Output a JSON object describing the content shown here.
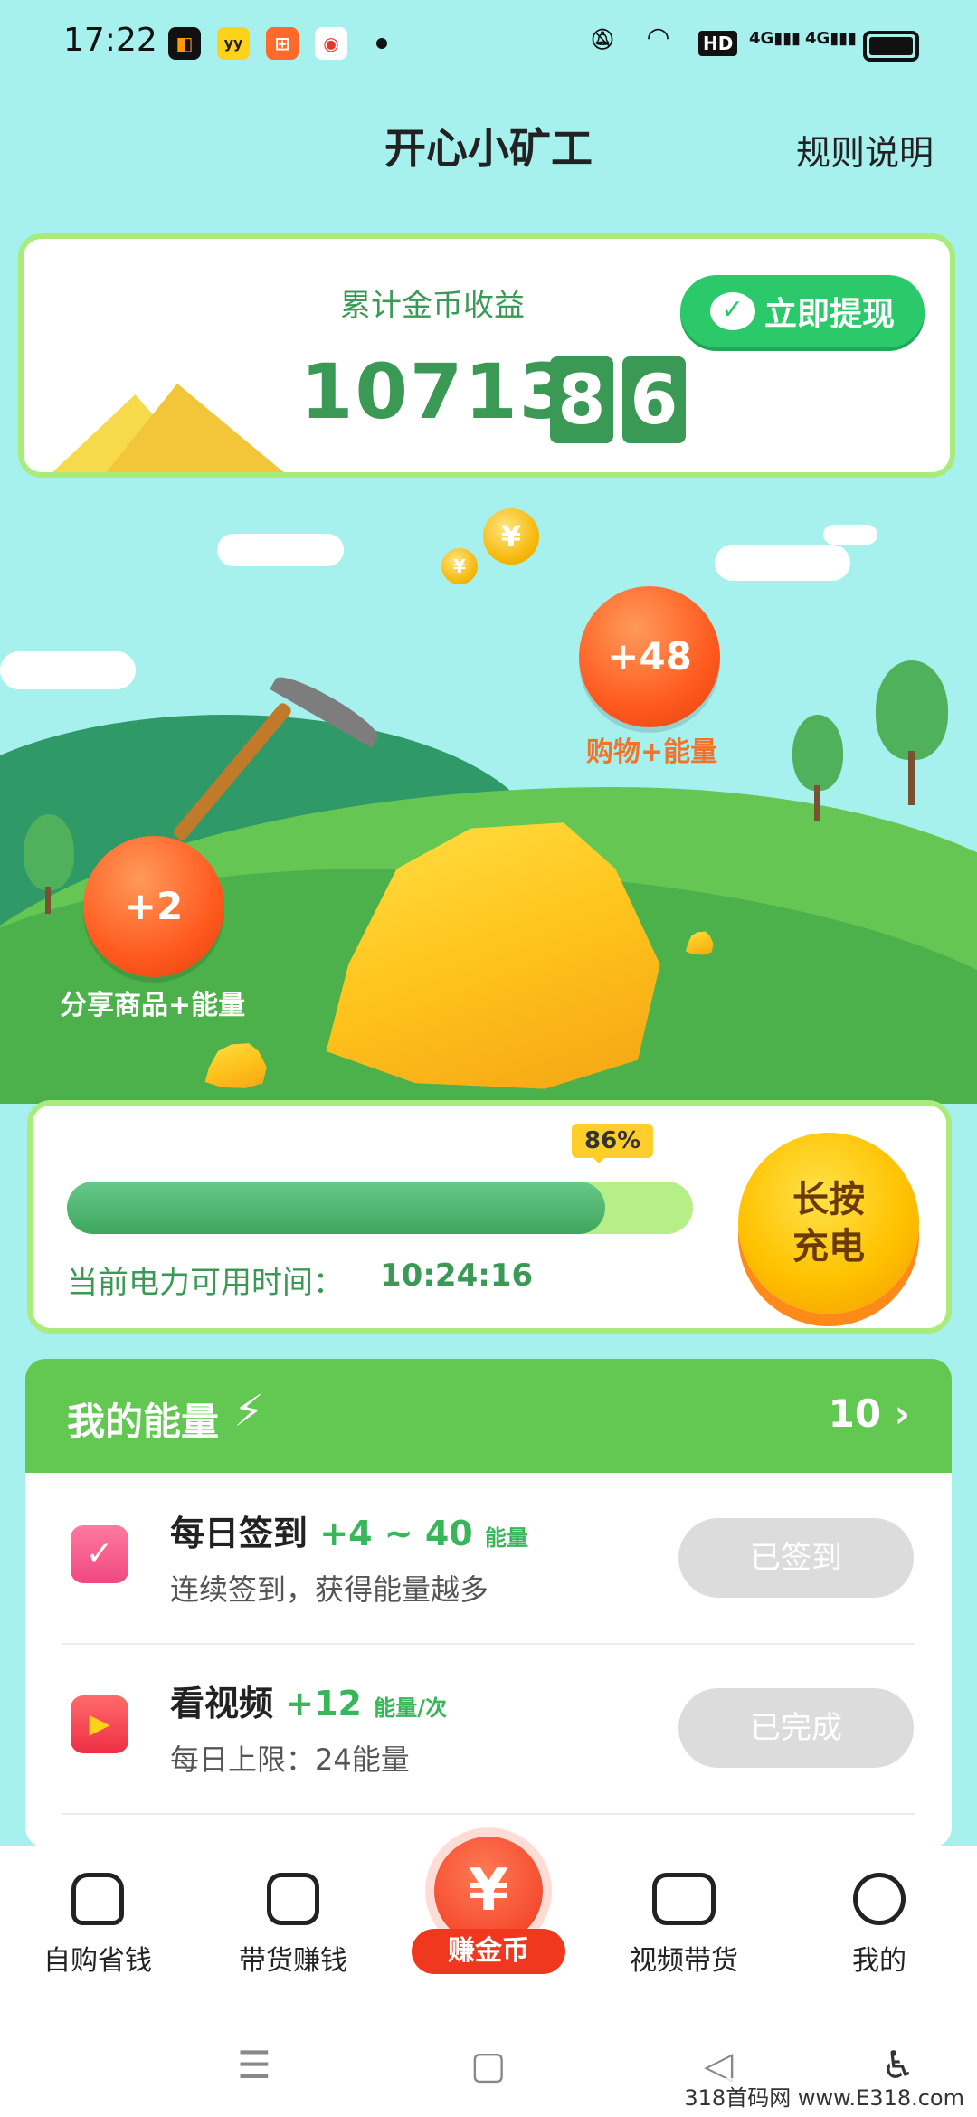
{
  "status": {
    "time": "17:22",
    "network": "HD",
    "signal1": "4G",
    "signal2": "4G"
  },
  "header": {
    "title": "开心小矿工",
    "rules": "规则说明"
  },
  "earnings": {
    "label": "累计金币收益",
    "amount_int": "10713.",
    "digit1": "8",
    "digit2": "6",
    "withdraw_label": "立即提现"
  },
  "scene": {
    "coin_symbol": "¥",
    "bubble_shopping_value": "+48",
    "bubble_shopping_label": "购物+能量",
    "bubble_share_value": "+2",
    "bubble_share_label": "分享商品+能量"
  },
  "power": {
    "percent": "86%",
    "percent_value": 0.86,
    "time_label": "当前电力可用时间：",
    "time_value": "10:24:16",
    "charge_line1": "长按",
    "charge_line2": "充电"
  },
  "energy": {
    "title": "我的能量",
    "count": "10 ›",
    "tasks": [
      {
        "title": "每日签到",
        "reward": "+4 ~ 40",
        "unit": "能量",
        "desc": "连续签到，获得能量越多",
        "button": "已签到"
      },
      {
        "title": "看视频",
        "reward": "+12",
        "unit": "能量/次",
        "desc": "每日上限：24能量",
        "button": "已完成"
      }
    ]
  },
  "nav": {
    "items": [
      {
        "label": "自购省钱"
      },
      {
        "label": "带货赚钱"
      },
      {
        "label": "赚金币",
        "symbol": "¥"
      },
      {
        "label": "视频带货"
      },
      {
        "label": "我的"
      }
    ]
  },
  "watermark": "318首码网 www.E318.com",
  "colors": {
    "sky": "#a6f0ee",
    "green_accent": "#3a9a55",
    "card_border": "#a9ec7c",
    "orange_bubble": "#ff5a1f"
  }
}
